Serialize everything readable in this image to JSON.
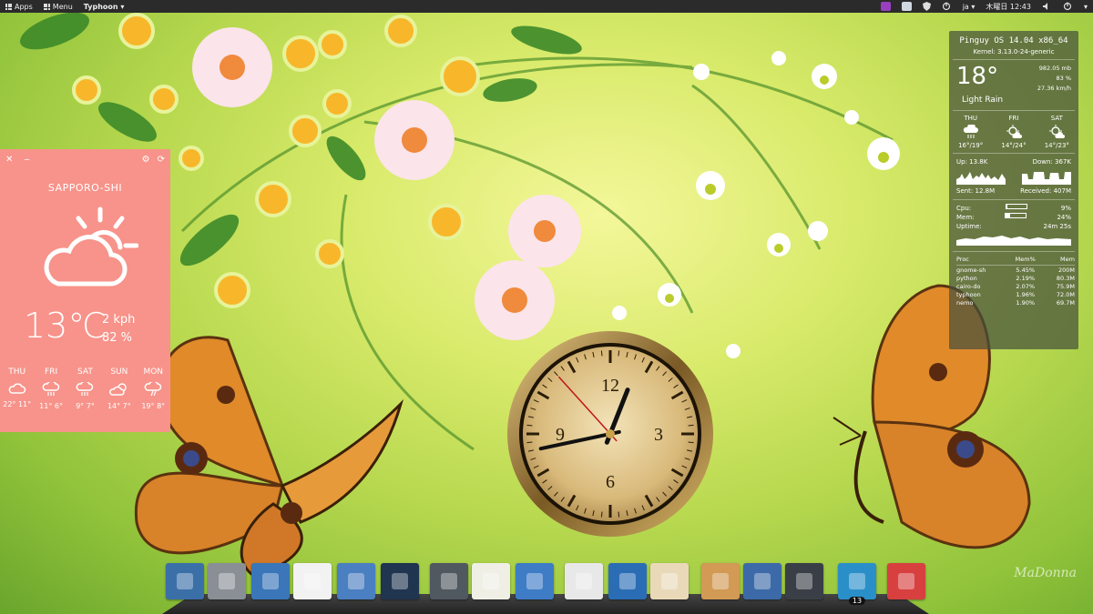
{
  "top_panel": {
    "apps_label": "Apps",
    "menu_label": "Menu",
    "typhoon_label": "Typhoon ▾",
    "keyboard_layout": "ja ▾",
    "clock": "木曜日 12:43"
  },
  "weather_widget": {
    "city": "SAPPORO-SHI",
    "temperature": "13℃",
    "wind": "2 kph",
    "humidity": "82 %",
    "condition_icon": "partly-cloudy-icon",
    "forecast": [
      {
        "day": "THU",
        "icon": "cloud-icon",
        "temps": "22° 11°"
      },
      {
        "day": "FRI",
        "icon": "rain-icon",
        "temps": "11° 6°"
      },
      {
        "day": "SAT",
        "icon": "rain-icon",
        "temps": "9° 7°"
      },
      {
        "day": "SUN",
        "icon": "partly-cloudy-icon",
        "temps": "14° 7°"
      },
      {
        "day": "MON",
        "icon": "cloud-rain-icon",
        "temps": "19° 8°"
      }
    ]
  },
  "sysmon": {
    "os": "Pinguy OS 14.04 x86_64",
    "kernel": "Kernel: 3.13.0-24-generic",
    "temp": "18°",
    "pressure": "982.05 mb",
    "humidity": "83 %",
    "wind": "27.36 km/h",
    "condition": "Light Rain",
    "forecast": [
      {
        "day": "THU",
        "temps": "16°/19°"
      },
      {
        "day": "FRI",
        "temps": "14°/24°"
      },
      {
        "day": "SAT",
        "temps": "14°/23°"
      }
    ],
    "up": "Up: 13.8K",
    "down": "Down: 367K",
    "sent": "Sent: 12.8M",
    "received": "Received: 407M",
    "cpu_label": "Cpu:",
    "cpu_value": "9%",
    "cpu_level": 0.09,
    "mem_label": "Mem:",
    "mem_value": "24%",
    "mem_level": 0.24,
    "uptime_label": "Uptime:",
    "uptime_value": "24m 25s",
    "proc_headers": [
      "Proc",
      "Mem%",
      "Mem"
    ],
    "processes": [
      {
        "name": "gnome-sh",
        "pct": "5.45%",
        "mem": "200M"
      },
      {
        "name": "python",
        "pct": "2.19%",
        "mem": "80.3M"
      },
      {
        "name": "cairo-do",
        "pct": "2.07%",
        "mem": "75.9M"
      },
      {
        "name": "typhoon",
        "pct": "1.96%",
        "mem": "72.0M"
      },
      {
        "name": "nemo",
        "pct": "1.90%",
        "mem": "69.7M"
      }
    ]
  },
  "clock_widget": {
    "numerals": [
      "12",
      "3",
      "6",
      "9"
    ],
    "time": "12:43"
  },
  "dock": {
    "items": [
      {
        "name": "apps-grid",
        "color": "#3b6fa8"
      },
      {
        "name": "file-manager",
        "color": "#8a8f96"
      },
      {
        "name": "download-manager",
        "color": "#3a76b8"
      },
      {
        "name": "software-center",
        "color": "#f2f2f2"
      },
      {
        "name": "settings",
        "color": "#4a7fc1"
      },
      {
        "name": "webcam",
        "color": "#1f3550"
      },
      {
        "name": "calculator",
        "color": "#505860"
      },
      {
        "name": "text-editor",
        "color": "#efefe6"
      },
      {
        "name": "writer",
        "color": "#3e7cc6"
      },
      {
        "name": "chrome",
        "color": "#e8e8e8"
      },
      {
        "name": "firefox",
        "color": "#2a6db5"
      },
      {
        "name": "mail",
        "color": "#e9d9b8"
      },
      {
        "name": "home-folder",
        "color": "#d29a55"
      },
      {
        "name": "desktop",
        "color": "#3c6aa8"
      },
      {
        "name": "terminal",
        "color": "#3a3f47"
      },
      {
        "name": "typhoon",
        "color": "#2a8fc9",
        "badge": "13"
      },
      {
        "name": "power",
        "color": "#d84040"
      }
    ]
  },
  "watermark": "MaDonna"
}
